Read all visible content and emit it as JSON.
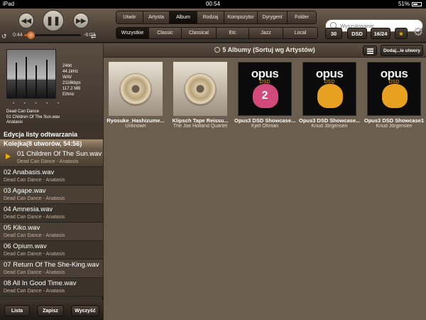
{
  "status": {
    "device": "iPad",
    "time": "00:54",
    "battery": "51%"
  },
  "player": {
    "elapsed": "0:44",
    "remaining": "-6:07",
    "progress": 0.11
  },
  "view_tabs": [
    {
      "label": "Utwór",
      "active": false
    },
    {
      "label": "Artysta",
      "active": false
    },
    {
      "label": "Album",
      "active": true
    },
    {
      "label": "Rodzaj",
      "active": false
    },
    {
      "label": "Kompozytor",
      "active": false
    },
    {
      "label": "Dyrygent",
      "active": false
    },
    {
      "label": "Folder",
      "active": false
    }
  ],
  "filter_tabs": [
    {
      "label": "Wszystkie",
      "active": true
    },
    {
      "label": "Classic",
      "active": false
    },
    {
      "label": "Classical",
      "active": false
    },
    {
      "label": "Etc",
      "active": false
    },
    {
      "label": "Jazz",
      "active": false
    },
    {
      "label": "Local",
      "active": false
    }
  ],
  "search": {
    "placeholder": "Wyszukiwanie"
  },
  "chips": {
    "count": "30",
    "dsd": "DSD",
    "bitdepth": "16/24",
    "star": "★"
  },
  "now_playing": {
    "meta": [
      "24bit",
      "44.1kHz",
      "WAV",
      "2116kbps",
      "117.2 MB",
      "Ethnic"
    ],
    "rating": "• • • • •",
    "artist": "Dead Can Dance",
    "track": "01 Children Of The Sun.wav",
    "album": "Anatasis"
  },
  "playlist": {
    "header": "Edycja listy odtwarzania",
    "queue": "Kolejka(8 utworów, 54:56)",
    "tracks": [
      {
        "title": "01 Children Of The Sun.wav",
        "sub": "Dead Can Dance - Anatasis"
      },
      {
        "title": "02 Anabasis.wav",
        "sub": "Dead Can Dance - Anatasis"
      },
      {
        "title": "03 Agape.wav",
        "sub": "Dead Can Dance - Anatasis"
      },
      {
        "title": "04 Amnesia.wav",
        "sub": "Dead Can Dance - Anatasis"
      },
      {
        "title": "05 Kiko.wav",
        "sub": "Dead Can Dance - Anatasis"
      },
      {
        "title": "06 Opium.wav",
        "sub": "Dead Can Dance - Anatasis"
      },
      {
        "title": "07 Return Of The She-King.wav",
        "sub": "Dead Can Dance - Anatasis"
      },
      {
        "title": "08 All In Good Time.wav",
        "sub": "Dead Can Dance - Anatasis"
      }
    ],
    "buttons": {
      "list": "Lista",
      "save": "Zapisz",
      "clear": "Wyczyść"
    }
  },
  "main": {
    "title": "5 Albumy (Sortuj wg Artystów)",
    "add_button": "Dodaj...ie utwory",
    "albums": [
      {
        "name": "Ryosuke_Hashizume...",
        "artist": "Unknown",
        "art": "cd"
      },
      {
        "name": "Klipsch Tape Reissu...",
        "artist": "The Joe Holland Quartet",
        "art": "cd"
      },
      {
        "name": "Opus3 DSD Showcase...",
        "artist": "Kjell Öhman",
        "art": "opus",
        "art_word": "opus",
        "art_sub": "DSD",
        "art_num": "2",
        "art_color": "#d24a7a"
      },
      {
        "name": "Opus3 DSD Showcase...",
        "artist": "Knud Jörgensen",
        "art": "opus",
        "art_word": "opus",
        "art_sub": "DSD",
        "art_num": "",
        "art_color": "#e8a020"
      },
      {
        "name": "Opus3 DSD Showcase1",
        "artist": "Knud Jörgensen",
        "art": "opus",
        "art_word": "opus",
        "art_sub": "DSD",
        "art_num": "",
        "art_color": "#e8a020"
      }
    ]
  }
}
